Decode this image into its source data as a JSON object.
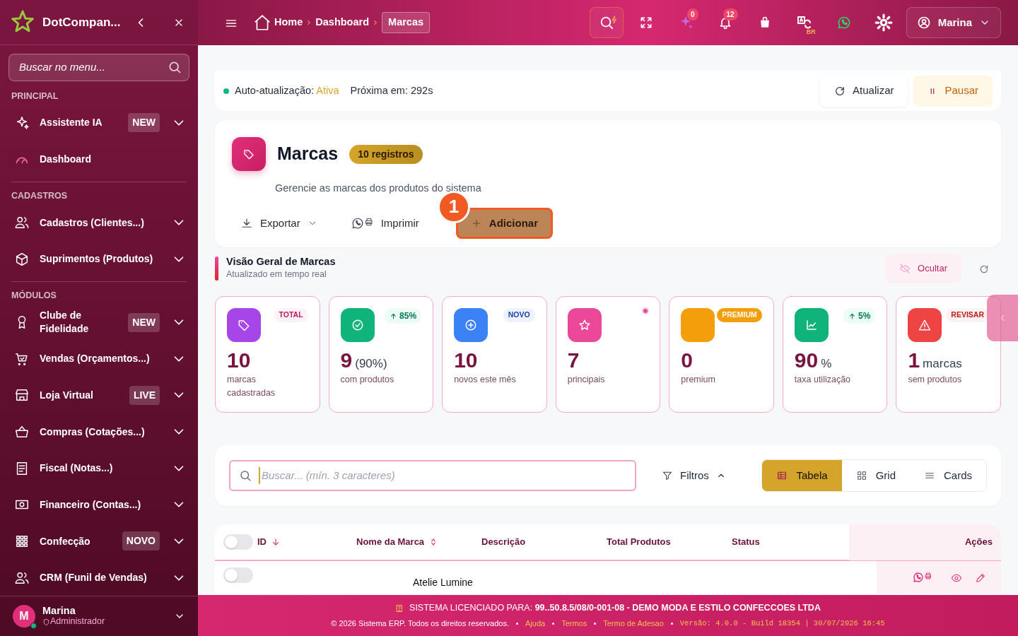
{
  "sidebar": {
    "brand": "DotCompan...",
    "search_placeholder": "Buscar no menu...",
    "sections": [
      {
        "title": "PRINCIPAL",
        "items": [
          {
            "label": "Assistente IA",
            "badge": "NEW",
            "expandable": true
          },
          {
            "label": "Dashboard",
            "expandable": false
          }
        ]
      },
      {
        "title": "CADASTROS",
        "items": [
          {
            "label": "Cadastros (Clientes...)",
            "expandable": true
          },
          {
            "label": "Suprimentos (Produtos)",
            "expandable": true
          }
        ]
      },
      {
        "title": "MÓDULOS",
        "items": [
          {
            "label": "Clube de Fidelidade",
            "badge": "NEW",
            "expandable": true
          },
          {
            "label": "Vendas (Orçamentos...)",
            "expandable": true
          },
          {
            "label": "Loja Virtual",
            "badge": "LIVE",
            "expandable": true
          },
          {
            "label": "Compras (Cotações...)",
            "expandable": true
          },
          {
            "label": "Fiscal (Notas...)",
            "expandable": true
          },
          {
            "label": "Financeiro (Contas...)",
            "expandable": true
          },
          {
            "label": "Confecção",
            "badge": "NOVO",
            "expandable": true
          },
          {
            "label": "CRM (Funil de Vendas)",
            "expandable": true
          }
        ]
      }
    ],
    "user": {
      "initial": "M",
      "name": "Marina",
      "role": "Administrador",
      "online": true
    }
  },
  "header": {
    "breadcrumb": [
      {
        "label": "Home",
        "selected": false
      },
      {
        "label": "Dashboard",
        "selected": false
      },
      {
        "label": "Marcas",
        "selected": true
      }
    ],
    "ai_count": "0",
    "notification_count": "12",
    "language": "BR",
    "user": "Marina"
  },
  "auto_refresh": {
    "label": "Auto-atualização:",
    "state": "Ativa",
    "next_label": "Próxima em:",
    "next_value": "292s",
    "refresh_button": "Atualizar",
    "pause_button": "Pausar"
  },
  "page": {
    "title": "Marcas",
    "count_badge": "10 registros",
    "subtitle": "Gerencie as marcas dos produtos do sistema",
    "export_button": "Exportar",
    "print_button": "Imprimir",
    "add_button": "Adicionar",
    "step_marker": "1"
  },
  "overview": {
    "title": "Visão Geral de Marcas",
    "subtitle": "Atualizado em tempo real",
    "hide_button": "Ocultar",
    "stats": [
      {
        "value": "10",
        "label": "marcas cadastradas",
        "badge": "TOTAL",
        "kind": "tag",
        "color": "#a645e8"
      },
      {
        "value": "9",
        "unit": "(90%)",
        "label": "com produtos",
        "badge": "85%",
        "kind": "trend",
        "color": "#10b47a"
      },
      {
        "value": "10",
        "label": "novos este mês",
        "badge": "NOVO",
        "kind": "info",
        "color": "#3b82f6"
      },
      {
        "value": "7",
        "label": "principais",
        "kind": "dot",
        "color": "#ec4899"
      },
      {
        "value": "0",
        "label": "premium",
        "badge": "PREMIUM",
        "kind": "premium",
        "color": "#f59e0b"
      },
      {
        "value": "90",
        "unit": "%",
        "label": "taxa utilização",
        "badge": "5%",
        "kind": "trend",
        "color": "#10b47a"
      },
      {
        "value": "1",
        "unit": "marcas",
        "label": "sem produtos",
        "badge": "REVISAR",
        "kind": "warn",
        "color": "#ef4444"
      }
    ]
  },
  "filters": {
    "search_placeholder": "Buscar... (mín. 3 caracteres)",
    "filters_button": "Filtros",
    "filters_expanded": true,
    "views": [
      {
        "label": "Tabela",
        "selected": true
      },
      {
        "label": "Grid",
        "selected": false
      },
      {
        "label": "Cards",
        "selected": false
      }
    ]
  },
  "table": {
    "select_all": false,
    "columns": [
      "ID",
      "Nome da Marca",
      "Descrição",
      "Total Produtos",
      "Status",
      "Ações"
    ],
    "rows": [
      {
        "selected": false,
        "name": "Atelie Lumine"
      }
    ]
  },
  "footer": {
    "license_label": "SISTEMA LICENCIADO PARA:",
    "license_value": "99..50.8.5/08/0-001-08 - DEMO MODA E ESTILO CONFECCOES LTDA",
    "copyright": "© 2026 Sistema ERP. Todos os direitos reservados.",
    "links": [
      "Ajuda",
      "Termos",
      "Termo de Adesao"
    ],
    "version": "Versão: 4.0.0 - Build 18354 | 30/07/2026 16:45"
  }
}
